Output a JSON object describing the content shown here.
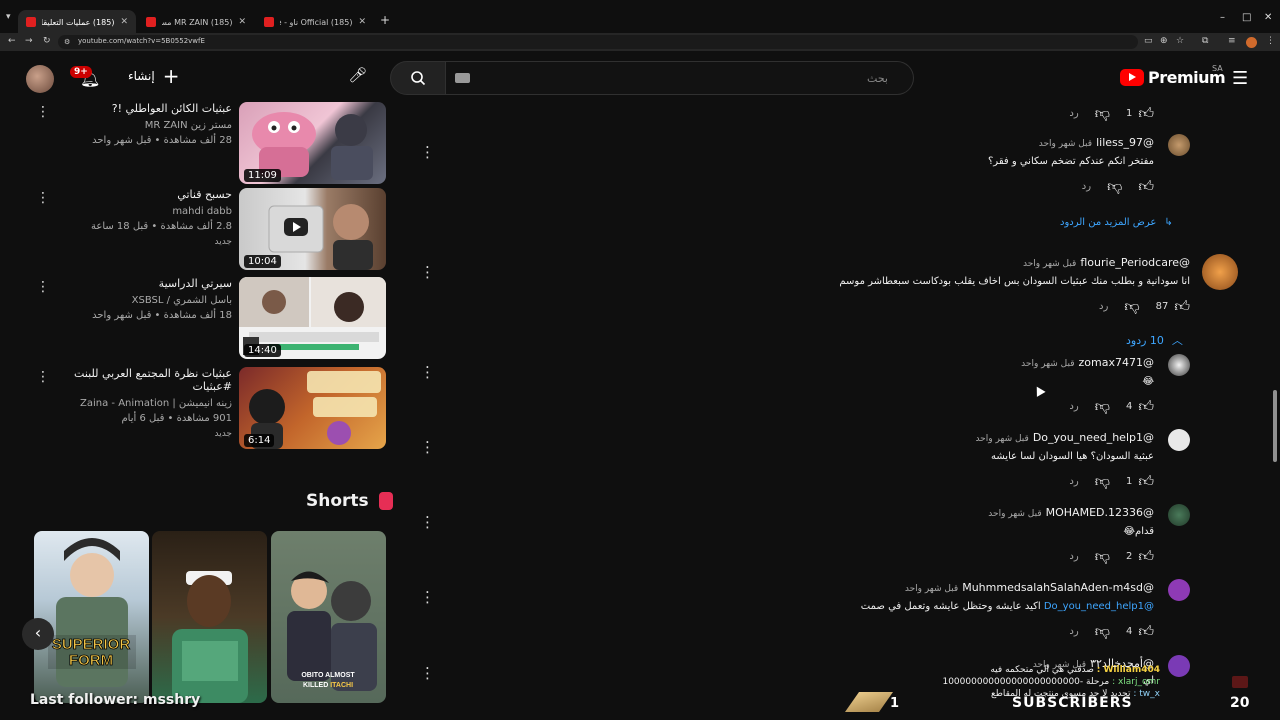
{
  "browser": {
    "tabs": [
      {
        "title": "(185) عمليات التعليقات السلبية"
      },
      {
        "title": "(185) MR ZAIN مستر زين - You"
      },
      {
        "title": "(185) Official ناو - YouTube"
      }
    ],
    "new_tab": "+",
    "url": "youtube.com/watch?v=5B0552vwfE"
  },
  "masthead": {
    "notification_count": "9+",
    "create_label": "إنشاء",
    "search_placeholder": "بحث",
    "logo_text": "Premium",
    "region": "SA"
  },
  "recommendations": [
    {
      "title": "عبثيات الكائن العواطلي !?",
      "channel": "مستر زين MR ZAIN",
      "views": "28 ألف مشاهدة • قبل شهر واحد",
      "duration": "11:09",
      "badge": ""
    },
    {
      "title": "حسبح قناتي",
      "channel": "mahdi dabb",
      "views": "2.8 ألف مشاهدة • قبل 18 ساعة",
      "duration": "10:04",
      "badge": "جديد"
    },
    {
      "title": "سيرتي الدراسية",
      "channel": "باسل الشمري / XSBSL",
      "views": "18 ألف مشاهدة • قبل شهر واحد",
      "duration": "14:40",
      "badge": ""
    },
    {
      "title": "عبثيات نظرة المجتمع العربي للبنت #عبثيات",
      "channel": "زينه انيميشن | Zaina - Animation",
      "views": "901 مشاهدة • قبل 6 أيام",
      "duration": "6:14",
      "badge": "جديد"
    }
  ],
  "shorts": {
    "title": "Shorts",
    "items": [
      {
        "caption": "SUPERIOR FORM"
      },
      {
        "caption": ""
      },
      {
        "caption": "OBITO ALMOST KILLED ITACHI"
      }
    ]
  },
  "comments": {
    "reply_label": "رد",
    "show_more_replies": "عرض المزيد من الردود",
    "replies_toggle": "10 ردود",
    "top_likes": "1",
    "items": [
      {
        "author": "@liless_97",
        "time": "قبل شهر واحد",
        "text": "مفتخر انكم عندكم تضخم سكاني و فقر؟",
        "likes": "",
        "mention": ""
      },
      {
        "author": "@flourie_Periodcare",
        "time": "قبل شهر واحد",
        "text": "انا سودانية و بطلب منك عبثيات السودان بس اخاف يقلب بودكاست سبعطاشر موسم",
        "likes": "87",
        "mention": ""
      },
      {
        "author": "@zomax7471",
        "time": "قبل شهر واحد",
        "text": "😂",
        "likes": "4",
        "mention": ""
      },
      {
        "author": "@Do_you_need_help1",
        "time": "قبل شهر واحد",
        "text": "عبثية السودان؟ هيا السودان لسا عايشه",
        "likes": "1",
        "mention": ""
      },
      {
        "author": "@MOHAMED.12336",
        "time": "قبل شهر واحد",
        "text": "قدام😂",
        "likes": "2",
        "mention": ""
      },
      {
        "author": "@MuhmmedsalahSalahAden-m4sd",
        "time": "قبل شهر واحد",
        "text": "اكيد عايشه وحتظل عايشه وتعمل في صمت",
        "likes": "4",
        "mention": "@Do_you_need_help1"
      },
      {
        "author": "@أمجدخالد٣٢",
        "time": "قبل شهر واحد",
        "text": "اي",
        "likes": "",
        "mention": ""
      }
    ]
  },
  "overlay": {
    "last_follower": "Last follower: msshry",
    "chat": [
      {
        "user": "William404 :",
        "msg": "صدقني هي الي متحكمه فيه"
      },
      {
        "user": "xlarj_omr :",
        "msg": "مرحلة -100000000000000000000000"
      },
      {
        "user": "tw_x :",
        "msg": "تحديد لا حد مسوي منتجت له المقاطع"
      }
    ],
    "subscribers_count": "1",
    "subscribers_label": "SUBSCRIBERS",
    "subscribers_goal": "20"
  }
}
